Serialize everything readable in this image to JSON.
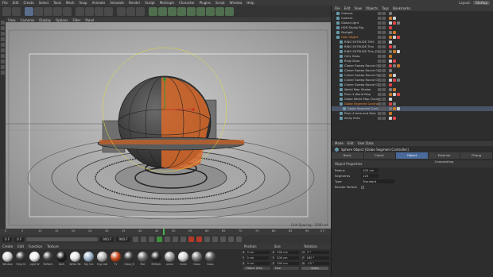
{
  "menubar": {
    "items": [
      "File",
      "Edit",
      "Create",
      "Select",
      "Tools",
      "Mesh",
      "Snap",
      "Animate",
      "Simulate",
      "Render",
      "Sculpt",
      "MoGraph",
      "Character",
      "Plugins",
      "Script",
      "Window",
      "Help"
    ],
    "layout_label": "Layout:",
    "layout_value": "Startup"
  },
  "viewport": {
    "menu": [
      "View",
      "Cameras",
      "Display",
      "Options",
      "Filter",
      "Panel"
    ],
    "grid_spacing": "Grid Spacing : 1000 cm"
  },
  "timeline": {
    "ticks": [
      "0",
      "5",
      "10",
      "15",
      "20",
      "25",
      "30",
      "35",
      "40",
      "45",
      "50",
      "55",
      "60",
      "65",
      "70",
      "75",
      "80",
      "85",
      "90"
    ],
    "end_label": "0 F",
    "current_frame": "0 F",
    "start_frame": "0 F",
    "end_frame": "900 F",
    "max_frame": "900 F"
  },
  "materials": {
    "menu": [
      "Create",
      "Edit",
      "Function",
      "Texture"
    ],
    "items": [
      {
        "label": "Window",
        "color": "#d8d8d8"
      },
      {
        "label": "Ring Gr",
        "color": "#3b3b3b"
      },
      {
        "label": "Light W",
        "color": "#f0f0f0"
      },
      {
        "label": "Reflecti",
        "color": "#444444"
      },
      {
        "label": "Dark",
        "color": "#1e1e1e"
      },
      {
        "label": "White Re",
        "color": "#e5e5e5"
      },
      {
        "label": "Sky Cal",
        "color": "#9fb6cc"
      },
      {
        "label": "Fog Cab",
        "color": "#b5b5b5"
      },
      {
        "label": "TV",
        "color": "#c94b1d"
      },
      {
        "label": "Glass_R",
        "color": "#3c3c3c"
      },
      {
        "label": "Mat",
        "color": "#6e6e6e"
      },
      {
        "label": "Reflecti",
        "color": "#2b2b2b"
      },
      {
        "label": "pewe",
        "color": "#9a9a9a"
      },
      {
        "label": "Gram",
        "color": "#d4d4d4"
      },
      {
        "label": "Glass",
        "color": "#7b7b7b"
      },
      {
        "label": "Glass",
        "color": "#5d5d5d"
      }
    ]
  },
  "coords": {
    "headers": [
      "Position",
      "Size",
      "Rotation"
    ],
    "rows": [
      {
        "axis": "X",
        "pos": "0 cm",
        "size": "200 cm",
        "rot_axis": "H",
        "rot": "0 °"
      },
      {
        "axis": "Y",
        "pos": "0 cm",
        "size": "200 cm",
        "rot_axis": "P",
        "rot": "180 °"
      },
      {
        "axis": "Z",
        "pos": "0 cm",
        "size": "200 cm",
        "rot_axis": "B",
        "rot": "-13 °"
      }
    ],
    "mode": "Object (Rel)",
    "size_mode": "Size",
    "apply": "Apply"
  },
  "objects": {
    "menu": [
      "File",
      "Edit",
      "View",
      "Objects",
      "Tags",
      "Bookmarks"
    ],
    "rows": [
      {
        "name": "Camera",
        "indent": 1,
        "style": "normal"
      },
      {
        "name": "Camera",
        "indent": 1,
        "style": "normal"
      },
      {
        "name": "Global Light",
        "indent": 1,
        "style": "normal"
      },
      {
        "name": "HDR Studio Rig",
        "indent": 1,
        "style": "normal"
      },
      {
        "name": "Skylight",
        "indent": 1,
        "style": "normal"
      },
      {
        "name": "Hole Object",
        "indent": 1,
        "style": "orange"
      },
      {
        "name": "RING EXTRUDE.THIS",
        "indent": 2,
        "style": "normal"
      },
      {
        "name": "RING EXTRUDE.Thin",
        "indent": 2,
        "style": "normal"
      },
      {
        "name": "RING EXTRUDE.Thin_Down",
        "indent": 2,
        "style": "normal"
      },
      {
        "name": "Only Glass",
        "indent": 2,
        "style": "normal"
      },
      {
        "name": "Ring Glass",
        "indent": 2,
        "style": "normal"
      },
      {
        "name": "Cloner Sweep Round 01",
        "indent": 2,
        "style": "normal"
      },
      {
        "name": "Cloner Sweep Round 02",
        "indent": 2,
        "style": "normal"
      },
      {
        "name": "Cloner Sweep Round 03",
        "indent": 2,
        "style": "normal"
      },
      {
        "name": "Cloner Sweep Round 04",
        "indent": 2,
        "style": "normal"
      },
      {
        "name": "Cloner Sweep Round 04.1",
        "indent": 2,
        "style": "normal"
      },
      {
        "name": "World Map Shader",
        "indent": 2,
        "style": "normal"
      },
      {
        "name": "Plain 4 World Map",
        "indent": 2,
        "style": "normal"
      },
      {
        "name": "Globe World Map Cloner",
        "indent": 2,
        "style": "normal"
      },
      {
        "name": "Globe Segment Controller",
        "indent": 2,
        "style": "orange"
      },
      {
        "name": "Globe Segment Controller",
        "indent": 3,
        "style": "selected"
      },
      {
        "name": "Plain 4 Area and Dots",
        "indent": 2,
        "style": "normal"
      },
      {
        "name": "Array lines",
        "indent": 2,
        "style": "normal"
      }
    ]
  },
  "attributes": {
    "menu": [
      "Mode",
      "Edit",
      "User Data"
    ],
    "title": "Sphere Object [Globe Segment Controller]",
    "tabs": [
      "Basic",
      "Coord.",
      "Object",
      "External Compositing",
      "Phong"
    ],
    "active_tab": "Object",
    "section": "Object Properties",
    "fields": [
      {
        "label": "Radius",
        "value": "100 cm"
      },
      {
        "label": "Segments",
        "value": "120"
      },
      {
        "label": "Type",
        "value": "Standard"
      },
      {
        "label": "Render Perfect",
        "value": "✓"
      }
    ]
  },
  "colors": {
    "accent_orange": "#e0692a",
    "selection_blue": "#4a6a9a",
    "viewport_bg": "#9b9b9b"
  }
}
